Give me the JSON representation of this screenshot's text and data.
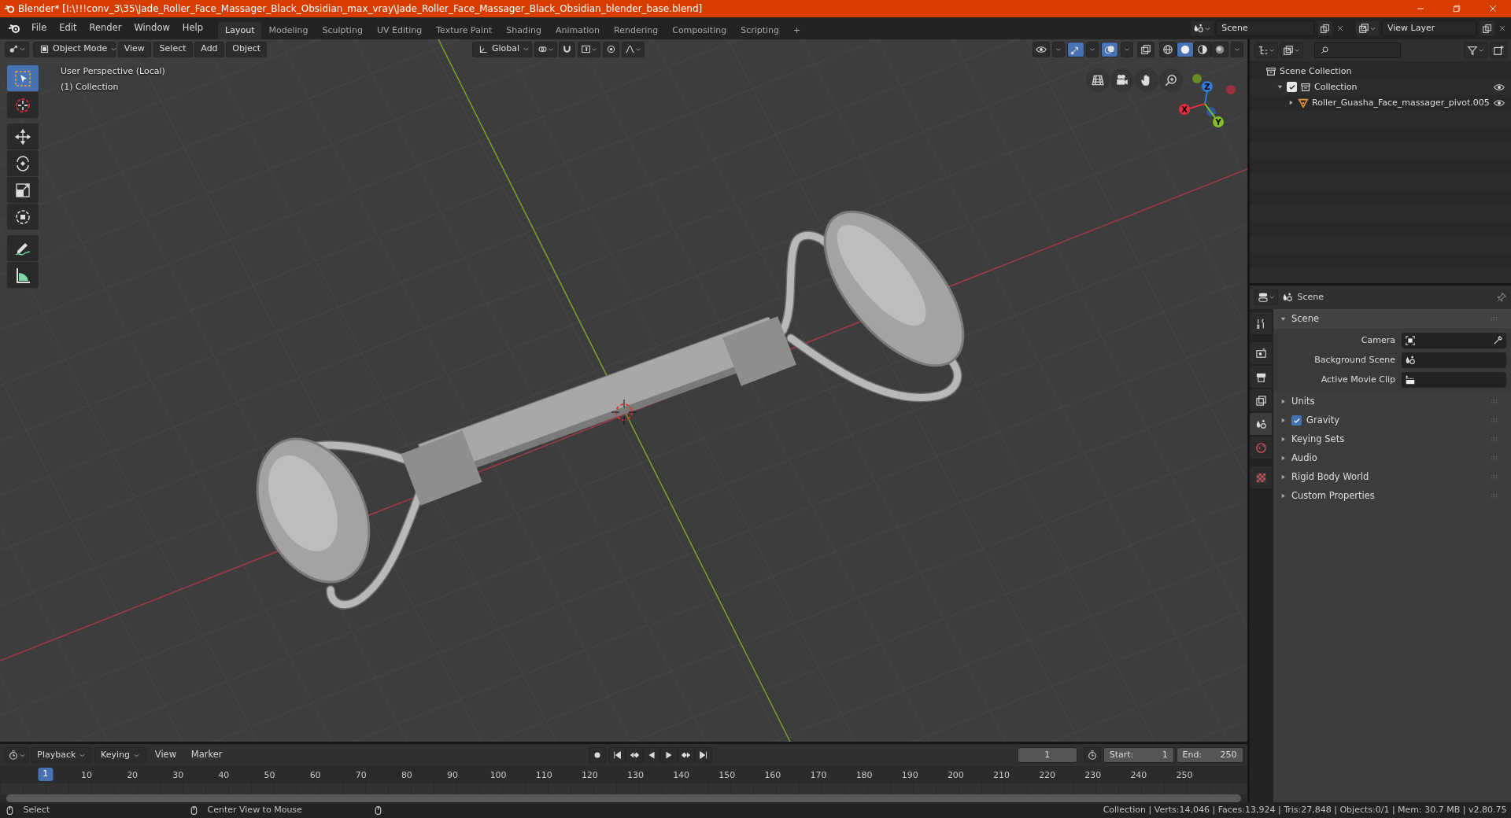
{
  "title_bar": {
    "title": "Blender* [I:\\!!!conv_3\\35\\Jade_Roller_Face_Massager_Black_Obsidian_max_vray\\Jade_Roller_Face_Massager_Black_Obsidian_blender_base.blend]"
  },
  "menu": [
    "File",
    "Edit",
    "Render",
    "Window",
    "Help"
  ],
  "workspaces": [
    {
      "label": "Layout",
      "selected": true
    },
    {
      "label": "Modeling",
      "selected": false
    },
    {
      "label": "Sculpting",
      "selected": false
    },
    {
      "label": "UV Editing",
      "selected": false
    },
    {
      "label": "Texture Paint",
      "selected": false
    },
    {
      "label": "Shading",
      "selected": false
    },
    {
      "label": "Animation",
      "selected": false
    },
    {
      "label": "Rendering",
      "selected": false
    },
    {
      "label": "Compositing",
      "selected": false
    },
    {
      "label": "Scripting",
      "selected": false
    }
  ],
  "add_workspace": "+",
  "scene": "Scene",
  "view_layer": "View Layer",
  "viewport": {
    "mode": "Object Mode",
    "menus": [
      "View",
      "Select",
      "Add",
      "Object"
    ],
    "orientation": "Global",
    "shading_modes": [
      {
        "kind": "wireframe",
        "selected": false
      },
      {
        "kind": "solid",
        "selected": true
      },
      {
        "kind": "material",
        "selected": false
      },
      {
        "kind": "rendered",
        "selected": false
      }
    ],
    "tools": [
      {
        "kind": "select",
        "selected": true
      },
      {
        "kind": "cursor",
        "selected": false
      },
      {
        "kind": "move",
        "selected": false
      },
      {
        "kind": "rotate",
        "selected": false
      },
      {
        "kind": "scale",
        "selected": false
      },
      {
        "kind": "transform",
        "selected": false
      },
      {
        "kind": "annotate",
        "selected": false
      },
      {
        "kind": "measure",
        "selected": false
      }
    ],
    "overlay_text": [
      "User Perspective (Local)",
      "(1) Collection"
    ],
    "gizmo": {
      "x": "X",
      "y": "Y",
      "z": "Z"
    }
  },
  "outliner": {
    "items": [
      {
        "label": "Scene Collection",
        "children": [
          {
            "label": "Collection",
            "checked": true,
            "expanded": true,
            "children": [
              {
                "label": "Roller_Guasha_Face_massager_pivot.005",
                "expanded": false
              }
            ]
          }
        ]
      }
    ]
  },
  "properties": {
    "title": "Scene",
    "tabs": [
      {
        "kind": "tool",
        "selected": false
      },
      {
        "kind": "render",
        "selected": false
      },
      {
        "kind": "output",
        "selected": false
      },
      {
        "kind": "view_layer",
        "selected": false
      },
      {
        "kind": "scene",
        "selected": true
      },
      {
        "kind": "world",
        "selected": false
      },
      {
        "kind": "texture",
        "selected": false
      }
    ],
    "panel": {
      "label": "Scene",
      "expanded": true,
      "fields": [
        {
          "label": "Camera",
          "kind": "camera"
        },
        {
          "label": "Background Scene",
          "kind": "scene"
        },
        {
          "label": "Active Movie Clip",
          "kind": "clip"
        }
      ]
    },
    "subpanels": [
      {
        "label": "Units",
        "kind": "plain",
        "expanded": false
      },
      {
        "label": "Gravity",
        "kind": "checkbox",
        "checked": true,
        "expanded": false
      },
      {
        "label": "Keying Sets",
        "kind": "plain",
        "expanded": false
      },
      {
        "label": "Audio",
        "kind": "plain",
        "expanded": false
      },
      {
        "label": "Rigid Body World",
        "kind": "plain",
        "expanded": false
      },
      {
        "label": "Custom Properties",
        "kind": "plain",
        "expanded": false
      }
    ]
  },
  "timeline": {
    "menus": [
      {
        "label": "Playback",
        "kind": "dropdown"
      },
      {
        "label": "Keying",
        "kind": "dropdown"
      },
      {
        "label": "View",
        "kind": "plain"
      },
      {
        "label": "Marker",
        "kind": "plain"
      }
    ],
    "current_frame": "1",
    "start_label": "Start:",
    "start": "1",
    "end_label": "End:",
    "end": "250",
    "playhead": "1",
    "ticks": [
      "10",
      "20",
      "30",
      "40",
      "50",
      "60",
      "70",
      "80",
      "90",
      "100",
      "110",
      "120",
      "130",
      "140",
      "150",
      "160",
      "170",
      "180",
      "190",
      "200",
      "210",
      "220",
      "230",
      "240",
      "250"
    ]
  },
  "status_bar": {
    "hints": [
      "Select",
      "Center View to Mouse"
    ],
    "stats": "Collection | Verts:14,046 | Faces:13,924 | Tris:27,848 | Objects:0/1 | Mem: 30.7 MB | v2.80.75"
  }
}
